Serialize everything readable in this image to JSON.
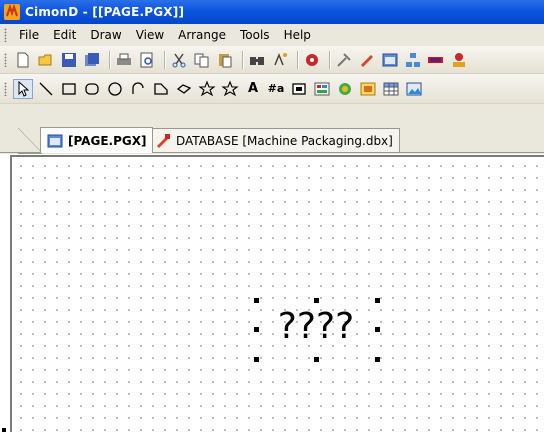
{
  "window": {
    "title": "CimonD - [[PAGE.PGX]]",
    "icon": "cimon-logo-icon"
  },
  "menu": [
    {
      "label": "File",
      "mnemonic": "F"
    },
    {
      "label": "Edit",
      "mnemonic": "E"
    },
    {
      "label": "Draw",
      "mnemonic": "D"
    },
    {
      "label": "View",
      "mnemonic": "V"
    },
    {
      "label": "Arrange",
      "mnemonic": "A"
    },
    {
      "label": "Tools",
      "mnemonic": "T"
    },
    {
      "label": "Help",
      "mnemonic": "H"
    }
  ],
  "toolbar_main": [
    "new-icon",
    "open-icon",
    "save-icon",
    "save-all-icon",
    "print-icon",
    "print-preview-icon",
    "cut-icon",
    "copy-icon",
    "paste-icon",
    "find-icon",
    "replace-icon",
    "tag-icon",
    "tools-icon",
    "database-icon",
    "page-icon",
    "network-icon",
    "battery-icon",
    "user-icon"
  ],
  "toolbar_draw": {
    "tools": [
      "select-icon",
      "line-icon",
      "rectangle-icon",
      "rounded-rectangle-icon",
      "ellipse-icon",
      "arc-icon",
      "polygon-icon",
      "polyline-icon",
      "star-icon",
      "star-outline-icon",
      "text-icon",
      "tag-text-icon",
      "button-icon",
      "image-icon",
      "symbol-icon",
      "bitmap-icon",
      "table-icon",
      "picture-icon"
    ],
    "text_glyph": "A",
    "tag_text_glyph": "#a"
  },
  "tabs": [
    {
      "label": "[PAGE.PGX]",
      "active": true,
      "icon": "page-icon"
    },
    {
      "label": "DATABASE [Machine Packaging.dbx]",
      "active": false,
      "icon": "database-icon"
    }
  ],
  "canvas": {
    "placeholder": "????"
  },
  "colors": {
    "titlebar": "#0b55e0",
    "chrome": "#eae8dc",
    "grid_dot": "#a8a8a8"
  }
}
